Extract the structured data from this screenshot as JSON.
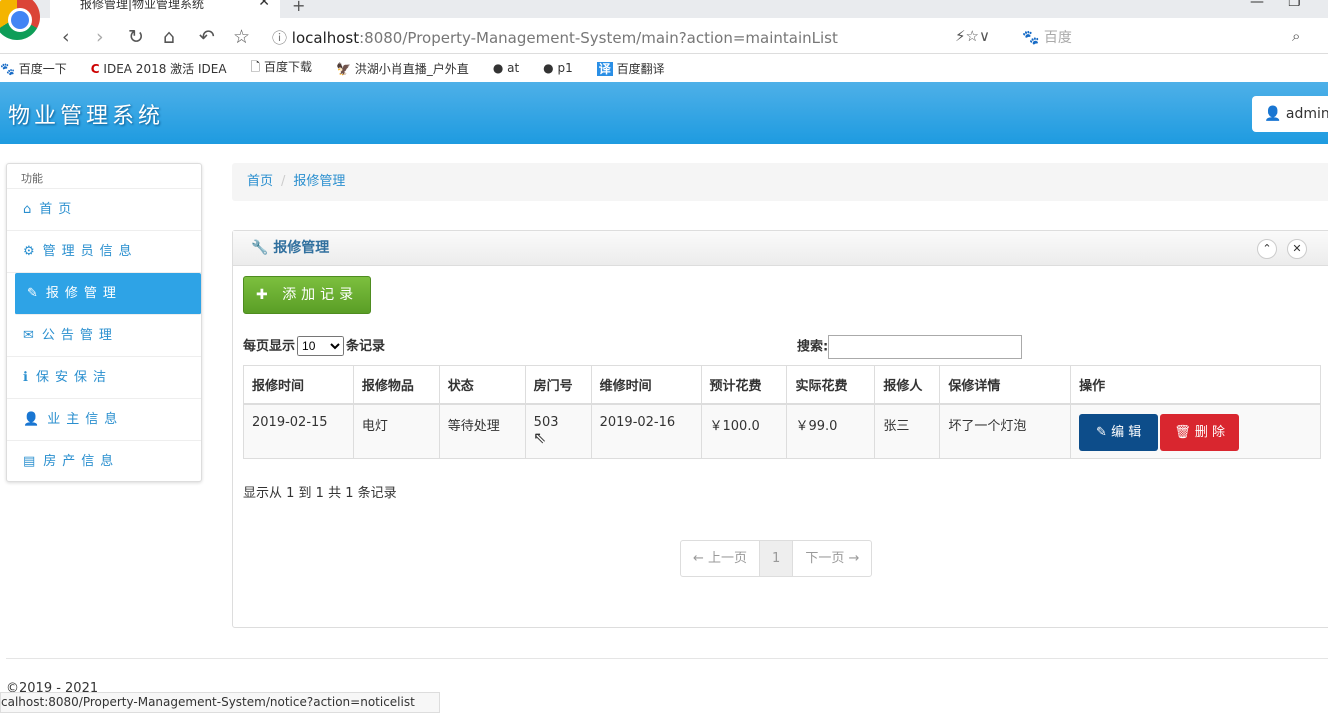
{
  "browser": {
    "tab_title": "报修管理|物业管理系统",
    "url_host": "localhost",
    "url_rest": ":8080/Property-Management-System/main?action=maintainList",
    "search_placeholder": "百度",
    "bookmarks": [
      "百度一下",
      "IDEA 2018 激活 IDEA",
      "百度下载",
      "洪湖小肖直播_户外直",
      "at",
      "p1",
      "百度翻译"
    ],
    "status_url": "calhost:8080/Property-Management-System/notice?action=noticelist"
  },
  "header": {
    "brand": "物业管理系统",
    "user": "admin ▾"
  },
  "sidebar": {
    "heading": "功能",
    "items": [
      {
        "icon": "⌂",
        "label": "首页"
      },
      {
        "icon": "⚙",
        "label": "管理员信息"
      },
      {
        "icon": "✎",
        "label": "报修管理"
      },
      {
        "icon": "✉",
        "label": "公告管理"
      },
      {
        "icon": "ℹ",
        "label": "保安保洁"
      },
      {
        "icon": "👤",
        "label": "业主信息"
      },
      {
        "icon": "▤",
        "label": "房产信息"
      }
    ]
  },
  "breadcrumb": [
    "首页",
    "报修管理"
  ],
  "panel": {
    "title": "报修管理",
    "add_label": "添加记录",
    "length_prefix": "每页显示",
    "length_value": "10",
    "length_suffix": "条记录",
    "search_label": "搜索:",
    "columns": [
      "报修时间",
      "报修物品",
      "状态",
      "房门号",
      "维修时间",
      "预计花费",
      "实际花费",
      "报修人",
      "保修详情",
      "操作"
    ],
    "rows": [
      [
        "2019-02-15",
        "电灯",
        "等待处理",
        "503",
        "2019-02-16",
        "￥100.0",
        "￥99.0",
        "张三",
        "坏了一个灯泡"
      ]
    ],
    "edit_label": "编 辑",
    "delete_label": "删 除",
    "info": "显示从 1 到 1 共 1 条记录",
    "pager": {
      "prev": "← 上一页",
      "current": "1",
      "next": "下一页 →"
    }
  },
  "footer": "©2019 - 2021"
}
